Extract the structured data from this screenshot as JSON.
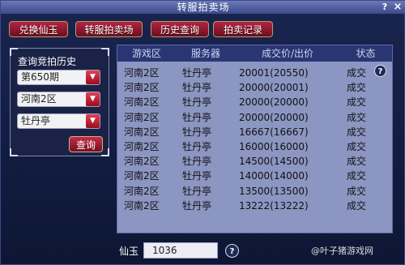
{
  "window": {
    "title": "转服拍卖场",
    "help_glyph": "?",
    "close_glyph": "×"
  },
  "tabs": [
    {
      "label": "兑换仙玉"
    },
    {
      "label": "转服拍卖场"
    },
    {
      "label": "历史查询"
    },
    {
      "label": "拍卖记录"
    }
  ],
  "query": {
    "title": "查询竞拍历史",
    "period": "第650期",
    "region": "河南2区",
    "server": "牡丹亭",
    "dropdown_glyph": "▼",
    "search_label": "查询"
  },
  "table": {
    "headers": [
      "游戏区",
      "服务器",
      "成交价/出价",
      "状态"
    ],
    "rows": [
      [
        "河南2区",
        "牡丹亭",
        "20001(20550)",
        "成交"
      ],
      [
        "河南2区",
        "牡丹亭",
        "20000(20001)",
        "成交"
      ],
      [
        "河南2区",
        "牡丹亭",
        "20000(20000)",
        "成交"
      ],
      [
        "河南2区",
        "牡丹亭",
        "20000(20000)",
        "成交"
      ],
      [
        "河南2区",
        "牡丹亭",
        "16667(16667)",
        "成交"
      ],
      [
        "河南2区",
        "牡丹亭",
        "16000(16000)",
        "成交"
      ],
      [
        "河南2区",
        "牡丹亭",
        "14500(14500)",
        "成交"
      ],
      [
        "河南2区",
        "牡丹亭",
        "14000(14000)",
        "成交"
      ],
      [
        "河南2区",
        "牡丹亭",
        "13500(13500)",
        "成交"
      ],
      [
        "河南2区",
        "牡丹亭",
        "13222(13222)",
        "成交"
      ]
    ],
    "help_glyph": "?"
  },
  "footer": {
    "label": "仙玉",
    "value": "1036",
    "help_glyph": "?"
  },
  "watermark": "@叶子猪游戏网"
}
